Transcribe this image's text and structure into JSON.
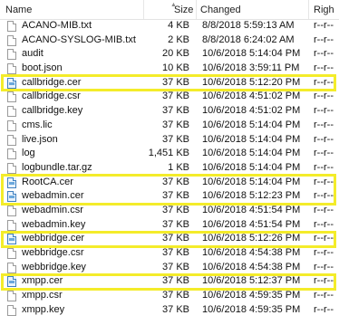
{
  "header": {
    "name": "Name",
    "size": "Size",
    "changed": "Changed",
    "rights": "Righ"
  },
  "files": [
    {
      "name": "ACANO-MIB.txt",
      "size": "4 KB",
      "changed": "8/8/2018 5:59:13 AM",
      "rights": "r--r--",
      "icon": "text-file-icon",
      "highlighted": false
    },
    {
      "name": "ACANO-SYSLOG-MIB.txt",
      "size": "2 KB",
      "changed": "8/8/2018 6:24:02 AM",
      "rights": "r--r--",
      "icon": "text-file-icon",
      "highlighted": false
    },
    {
      "name": "audit",
      "size": "20 KB",
      "changed": "10/6/2018 5:14:04 PM",
      "rights": "r--r--",
      "icon": "file-icon",
      "highlighted": false
    },
    {
      "name": "boot.json",
      "size": "10 KB",
      "changed": "10/6/2018 3:59:11 PM",
      "rights": "r--r--",
      "icon": "file-icon",
      "highlighted": false
    },
    {
      "name": "callbridge.cer",
      "size": "37 KB",
      "changed": "10/6/2018 5:12:20 PM",
      "rights": "r--r--",
      "icon": "certificate-icon",
      "highlighted": true
    },
    {
      "name": "callbridge.csr",
      "size": "37 KB",
      "changed": "10/6/2018 4:51:02 PM",
      "rights": "r--r--",
      "icon": "file-icon",
      "highlighted": false
    },
    {
      "name": "callbridge.key",
      "size": "37 KB",
      "changed": "10/6/2018 4:51:02 PM",
      "rights": "r--r--",
      "icon": "file-icon",
      "highlighted": false
    },
    {
      "name": "cms.lic",
      "size": "37 KB",
      "changed": "10/6/2018 5:14:04 PM",
      "rights": "r--r--",
      "icon": "file-icon",
      "highlighted": false
    },
    {
      "name": "live.json",
      "size": "37 KB",
      "changed": "10/6/2018 5:14:04 PM",
      "rights": "r--r--",
      "icon": "file-icon",
      "highlighted": false
    },
    {
      "name": "log",
      "size": "1,451 KB",
      "changed": "10/6/2018 5:14:04 PM",
      "rights": "r--r--",
      "icon": "file-icon",
      "highlighted": false
    },
    {
      "name": "logbundle.tar.gz",
      "size": "1 KB",
      "changed": "10/6/2018 5:14:04 PM",
      "rights": "r--r--",
      "icon": "file-icon",
      "highlighted": false
    },
    {
      "name": "RootCA.cer",
      "size": "37 KB",
      "changed": "10/6/2018 5:14:04 PM",
      "rights": "r--r--",
      "icon": "certificate-icon",
      "highlighted": true
    },
    {
      "name": "webadmin.cer",
      "size": "37 KB",
      "changed": "10/6/2018 5:12:23 PM",
      "rights": "r--r--",
      "icon": "certificate-icon",
      "highlighted": true
    },
    {
      "name": "webadmin.csr",
      "size": "37 KB",
      "changed": "10/6/2018 4:51:54 PM",
      "rights": "r--r--",
      "icon": "file-icon",
      "highlighted": false
    },
    {
      "name": "webadmin.key",
      "size": "37 KB",
      "changed": "10/6/2018 4:51:54 PM",
      "rights": "r--r--",
      "icon": "file-icon",
      "highlighted": false
    },
    {
      "name": "webbridge.cer",
      "size": "37 KB",
      "changed": "10/6/2018 5:12:26 PM",
      "rights": "r--r--",
      "icon": "certificate-icon",
      "highlighted": true
    },
    {
      "name": "webbridge.csr",
      "size": "37 KB",
      "changed": "10/6/2018 4:54:38 PM",
      "rights": "r--r--",
      "icon": "file-icon",
      "highlighted": false
    },
    {
      "name": "webbridge.key",
      "size": "37 KB",
      "changed": "10/6/2018 4:54:38 PM",
      "rights": "r--r--",
      "icon": "file-icon",
      "highlighted": false
    },
    {
      "name": "xmpp.cer",
      "size": "37 KB",
      "changed": "10/6/2018 5:12:37 PM",
      "rights": "r--r--",
      "icon": "certificate-icon",
      "highlighted": true
    },
    {
      "name": "xmpp.csr",
      "size": "37 KB",
      "changed": "10/6/2018 4:59:35 PM",
      "rights": "r--r--",
      "icon": "file-icon",
      "highlighted": false
    },
    {
      "name": "xmpp.key",
      "size": "37 KB",
      "changed": "10/6/2018 4:59:35 PM",
      "rights": "r--r--",
      "icon": "file-icon",
      "highlighted": false
    }
  ],
  "colors": {
    "highlight": "#f4ec2a",
    "certificate_icon": "#3f7fbf"
  }
}
